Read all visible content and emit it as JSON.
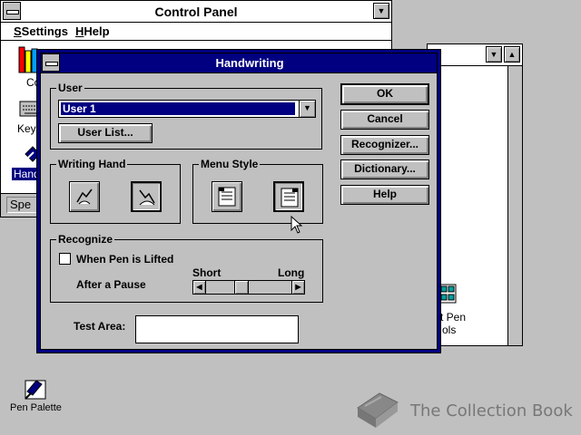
{
  "control_panel": {
    "title": "Control Panel",
    "menu": {
      "settings": "Settings",
      "help": "Help"
    },
    "icons": [
      {
        "label": "Co",
        "icon": "color-icon"
      },
      {
        "label": "Keyb",
        "icon": "keyboard-icon"
      },
      {
        "label": "Hand",
        "icon": "pen-icon",
        "selected": true
      }
    ],
    "status": "Spe"
  },
  "background_window": {
    "pen_tools_label_1": "oft Pen",
    "pen_tools_label_2": "ols"
  },
  "dialog": {
    "title": "Handwriting",
    "user": {
      "legend": "User",
      "selected": "User 1",
      "list_button": "User List..."
    },
    "writing_hand": {
      "legend": "Writing Hand",
      "selected": "right"
    },
    "menu_style": {
      "legend": "Menu Style",
      "selected": "right"
    },
    "recognize": {
      "legend": "Recognize",
      "checkbox_label": "When Pen is Lifted",
      "checked": false,
      "pause_label": "After a Pause",
      "slider_min_label": "Short",
      "slider_max_label": "Long",
      "slider_position": 0.4
    },
    "test_area": {
      "label": "Test Area:",
      "value": ""
    },
    "buttons": {
      "ok": "OK",
      "cancel": "Cancel",
      "recognizer": "Recognizer...",
      "dictionary": "Dictionary...",
      "help": "Help"
    }
  },
  "desktop": {
    "pen_palette_label": "Pen Palette",
    "watermark": "The Collection Book"
  },
  "colors": {
    "title_active": "#000080",
    "desktop": "#c0c0c0",
    "selection": "#000080"
  }
}
